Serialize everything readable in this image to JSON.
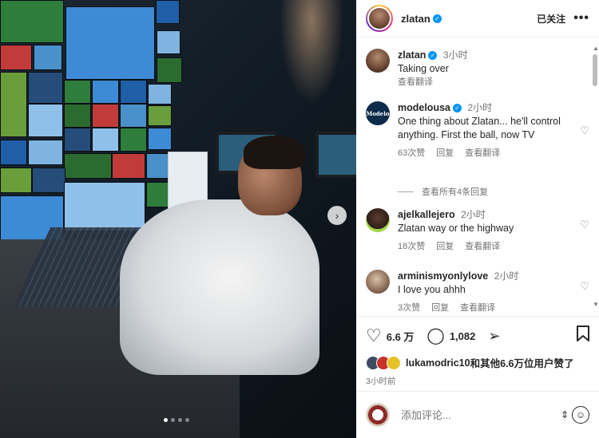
{
  "post": {
    "username": "zlatan",
    "follow_status": "已关注",
    "more_icon": "more-horizontal-icon"
  },
  "caption": {
    "username": "zlatan",
    "time": "3小时",
    "text": "Taking over",
    "translate": "查看翻译"
  },
  "comments": [
    {
      "username": "modelousa",
      "verified": true,
      "time": "2小时",
      "text": "One thing about Zlatan... he'll control anything. First the ball, now TV",
      "likes": "63次赞",
      "reply": "回复",
      "translate": "查看翻译",
      "avatar_text": "Modelo"
    },
    {
      "username": "ajelkallejero",
      "time": "2小时",
      "text": "Zlatan way or the highway",
      "likes": "18次赞",
      "reply": "回复",
      "translate": "查看翻译"
    },
    {
      "username": "arminismyonlylove",
      "time": "2小时",
      "text": "I love you ahhh",
      "likes": "3次赞",
      "reply": "回复",
      "translate": "查看翻译"
    }
  ],
  "view_replies": "查看所有4条回复",
  "actions": {
    "like_count": "6.6 万",
    "comment_count": "1,082"
  },
  "likes_summary": {
    "user": "lukamodric10",
    "rest": "和其他6.6万位用户赞了"
  },
  "post_time": "3小时前",
  "comment_input": {
    "placeholder": "添加评论..."
  },
  "carousel": {
    "slides": 4,
    "active": 1
  }
}
